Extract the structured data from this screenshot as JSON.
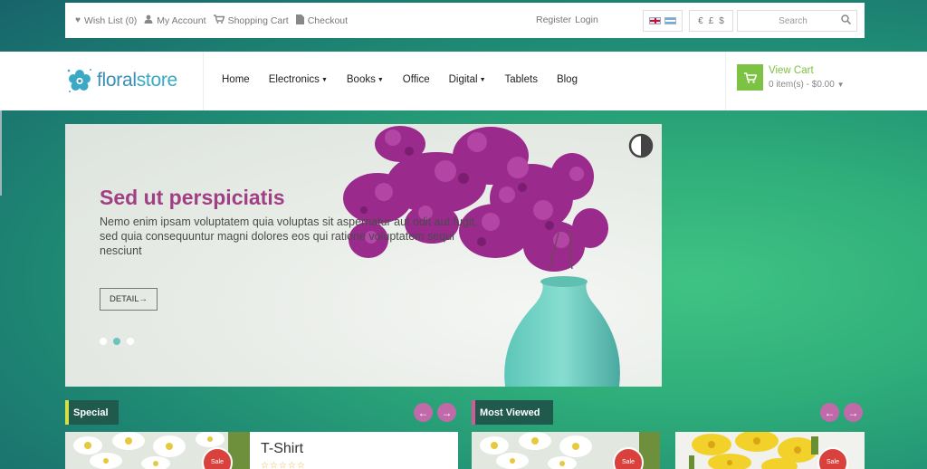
{
  "topbar": {
    "wishlist": "Wish List (0)",
    "account": "My Account",
    "cart": "Shopping Cart",
    "checkout": "Checkout",
    "register": "Register",
    "login": "Login",
    "currencies": [
      "€",
      "£",
      "$"
    ],
    "search_placeholder": "Search"
  },
  "logo": {
    "part1": "floral",
    "part2": "store"
  },
  "menu": {
    "home": "Home",
    "electronics": "Electronics",
    "books": "Books",
    "office": "Office",
    "digital": "Digital",
    "tablets": "Tablets",
    "blog": "Blog"
  },
  "cart": {
    "title": "View Cart",
    "summary": "0 item(s) - $0.00"
  },
  "slider": {
    "title": "Sed ut perspiciatis",
    "text": "Nemo enim ipsam voluptatem quia voluptas sit aspernatur aut odit aut fugit, sed quia consequuntur magni dolores eos qui ratione voluptatem sequi nesciunt",
    "button": "DETAIL→"
  },
  "special": {
    "title": "Special",
    "product_title": "T-Shirt",
    "sale": "Sale",
    "rating": "☆☆☆☆☆"
  },
  "most_viewed": {
    "title": "Most Viewed",
    "sale": "Sale"
  },
  "colors": {
    "accent_purple": "#a13f85",
    "cart_green": "#7cc243",
    "section_dark": "#1f5a4d",
    "sale_red": "#d9413c",
    "arrow_pink": "#c06aa9"
  }
}
